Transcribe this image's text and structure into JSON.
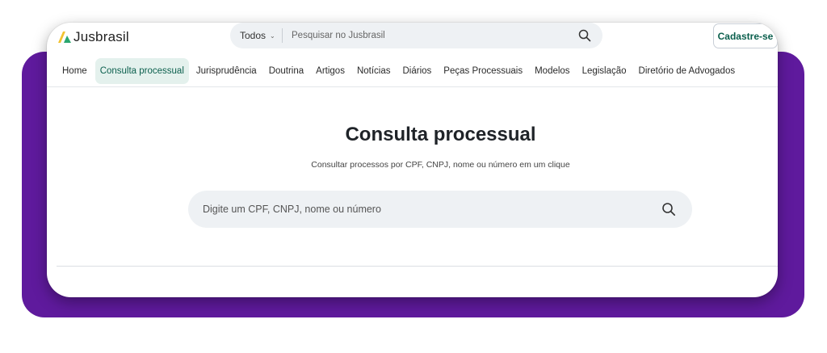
{
  "brand": {
    "name": "Jusbrasil"
  },
  "top_search": {
    "scope": "Todos",
    "placeholder": "Pesquisar no Jusbrasil"
  },
  "signup_label": "Cadastre-se",
  "nav": {
    "items": [
      {
        "label": "Home",
        "active": false
      },
      {
        "label": "Consulta processual",
        "active": true
      },
      {
        "label": "Jurisprudência",
        "active": false
      },
      {
        "label": "Doutrina",
        "active": false
      },
      {
        "label": "Artigos",
        "active": false
      },
      {
        "label": "Notícias",
        "active": false
      },
      {
        "label": "Diários",
        "active": false
      },
      {
        "label": "Peças Processuais",
        "active": false
      },
      {
        "label": "Modelos",
        "active": false
      },
      {
        "label": "Legislação",
        "active": false
      },
      {
        "label": "Diretório de Advogados",
        "active": false
      }
    ]
  },
  "main": {
    "title": "Consulta processual",
    "subtitle": "Consultar processos por CPF, CNPJ, nome ou número em um clique",
    "search_placeholder": "Digite um CPF, CNPJ, nome ou número"
  },
  "colors": {
    "backdrop": "#5f1a9d",
    "accent": "#0b5f4d",
    "active_tab_bg": "#e4f1ed",
    "logo_yellow": "#f2c230",
    "logo_green": "#2aa66e"
  },
  "icons": [
    "jusbrasil-logo-icon",
    "chevron-down-icon",
    "search-icon"
  ]
}
